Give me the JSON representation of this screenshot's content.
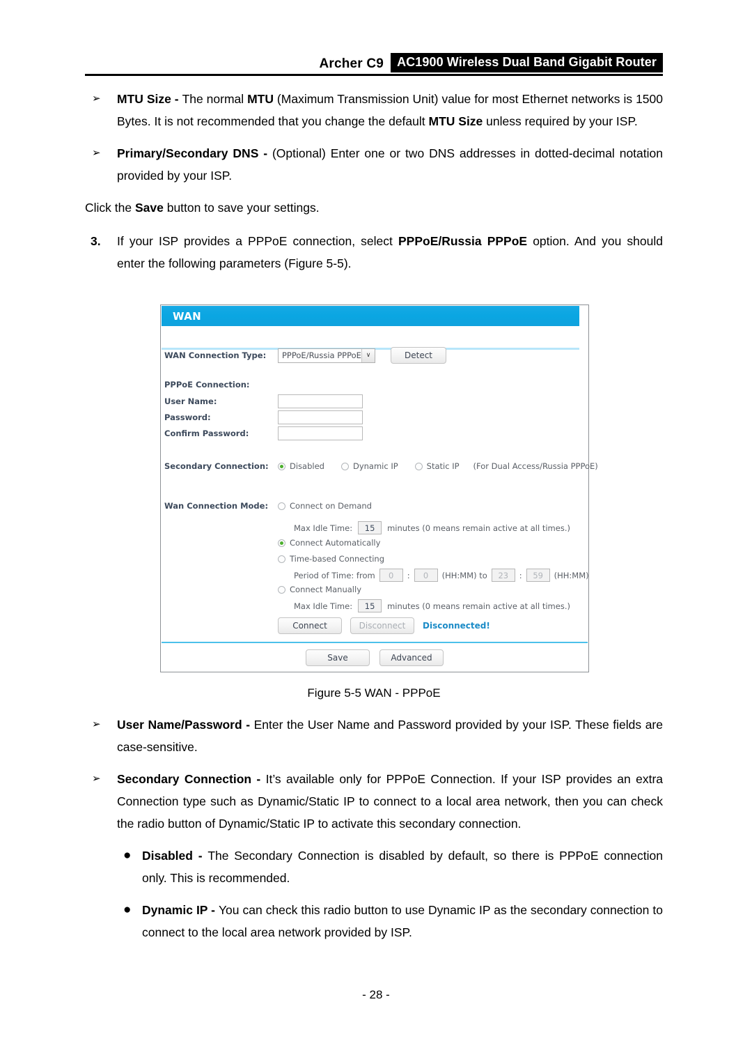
{
  "header": {
    "model": "Archer C9",
    "title": "AC1900 Wireless Dual Band Gigabit Router"
  },
  "body_top": {
    "mtu": {
      "marker": "➢",
      "term": "MTU Size - ",
      "text_1": "The normal ",
      "bold_1": "MTU",
      "text_2": " (Maximum Transmission Unit) value for most Ethernet networks is 1500 Bytes. It is not recommended that you change the default ",
      "bold_2": "MTU Size",
      "text_3": " unless required by your ISP."
    },
    "dns": {
      "marker": "➢",
      "term": "Primary/Secondary DNS - ",
      "text": "(Optional) Enter one or two DNS addresses in dotted-decimal notation provided by your ISP."
    },
    "save_note": {
      "text_1": "Click the ",
      "bold": "Save",
      "text_2": " button to save your settings."
    },
    "step3": {
      "marker": "3.",
      "text_1": "If your ISP provides a PPPoE connection, select ",
      "bold": "PPPoE/Russia PPPoE",
      "text_2": " option. And you should enter the following parameters (Figure 5-5)."
    }
  },
  "screenshot": {
    "panel_title": "WAN",
    "wan_connection_type": {
      "label": "WAN Connection Type:",
      "selected": "PPPoE/Russia PPPoE",
      "arrow": "∨",
      "detect_button": "Detect"
    },
    "pppoe_connection": {
      "section_label": "PPPoE Connection:",
      "fields": [
        {
          "label": "User Name:",
          "value": ""
        },
        {
          "label": "Password:",
          "value": ""
        },
        {
          "label": "Confirm Password:",
          "value": ""
        }
      ]
    },
    "secondary_connection": {
      "label": "Secondary Connection:",
      "options": [
        {
          "label": "Disabled",
          "selected": true
        },
        {
          "label": "Dynamic IP",
          "selected": false
        },
        {
          "label": "Static IP",
          "selected": false
        }
      ],
      "note": "(For Dual Access/Russia PPPoE)"
    },
    "wan_connection_mode": {
      "label": "Wan Connection Mode:",
      "connect_on_demand": {
        "label": "Connect on Demand",
        "selected": false
      },
      "on_demand_idle": {
        "label": "Max Idle Time:",
        "value": "15",
        "suffix": "minutes (0 means remain active at all times.)"
      },
      "connect_automatically": {
        "label": "Connect Automatically",
        "selected": true
      },
      "time_based": {
        "label": "Time-based Connecting",
        "selected": false
      },
      "period_of_time": {
        "prefix": "Period of Time: from",
        "from_hh": "0",
        "sep": ":",
        "from_mm": "0",
        "mid_1": "(HH:MM) to",
        "to_hh": "23",
        "to_mm": "59",
        "mid_2": "(HH:MM)"
      },
      "connect_manually": {
        "label": "Connect Manually",
        "selected": false
      },
      "manual_idle": {
        "label": "Max Idle Time:",
        "value": "15",
        "suffix": "minutes (0 means remain active at all times.)"
      },
      "connect_button": "Connect",
      "disconnect_button": "Disconnect",
      "status": "Disconnected!"
    },
    "footer": {
      "save_button": "Save",
      "advanced_button": "Advanced"
    },
    "colors": {
      "title_bar": "#0fa6e0",
      "accent_rule": "#4cc1ea",
      "status_text": "#1b8bc7",
      "radio_dot": "#4caf2e",
      "label_text": "#3d4a5c"
    }
  },
  "figure_caption": "Figure 5-5 WAN - PPPoE",
  "body_bottom": {
    "user_pass": {
      "marker": "➢",
      "term": "User Name/Password - ",
      "text": "Enter the User Name and Password provided by your ISP. These fields are case-sensitive."
    },
    "secondary": {
      "marker": "➢",
      "term": "Secondary Connection - ",
      "text": "It’s available only for PPPoE Connection. If your ISP provides an extra Connection type such as Dynamic/Static IP to connect to a local area network, then you can check the radio button of Dynamic/Static IP to activate this secondary connection."
    },
    "disabled": {
      "marker": "●",
      "term": "Disabled - ",
      "text": "The Secondary Connection is disabled by default, so there is PPPoE connection only. This is recommended."
    },
    "dynamic_ip": {
      "marker": "●",
      "term": "Dynamic IP - ",
      "text": "You can check this radio button to use Dynamic IP as the secondary connection to connect to the local area network provided by ISP."
    }
  },
  "page_number": "- 28 -"
}
